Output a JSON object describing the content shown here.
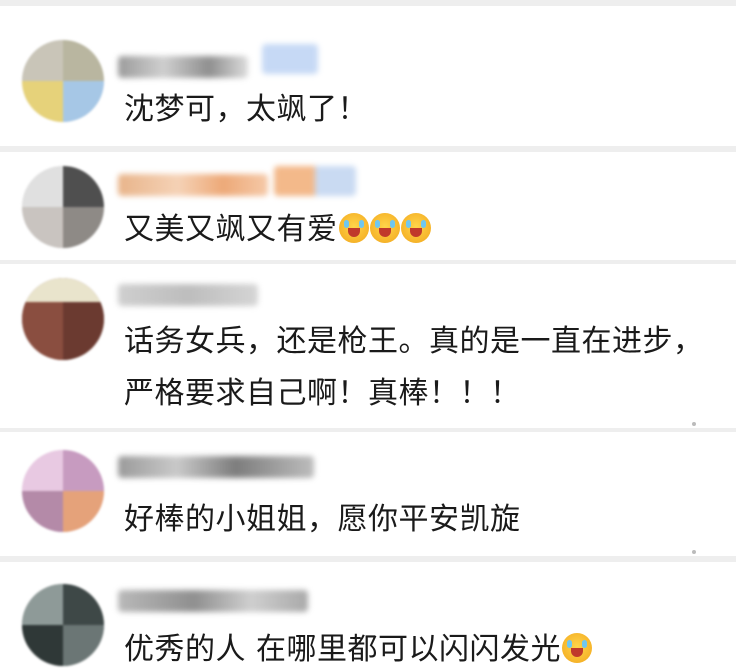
{
  "comments": [
    {
      "text": "沈梦可，太飒了！",
      "emoji_count": 0
    },
    {
      "text": "又美又飒又有爱",
      "emoji_count": 3,
      "emoji_name": "crying-laughing-emoji-icon"
    },
    {
      "text": "话务女兵，还是枪王。真的是一直在进步，严格要求自己啊！真棒！！！",
      "emoji_count": 0
    },
    {
      "text": "好棒的小姐姐，愿你平安凯旋",
      "emoji_count": 0
    },
    {
      "text": "优秀的人 在哪里都可以闪闪发光",
      "emoji_count": 1,
      "emoji_name": "blushing-emoji-icon"
    }
  ],
  "colors": {
    "background": "#eeeeee",
    "card": "#ffffff",
    "text": "#1a1a1a"
  }
}
